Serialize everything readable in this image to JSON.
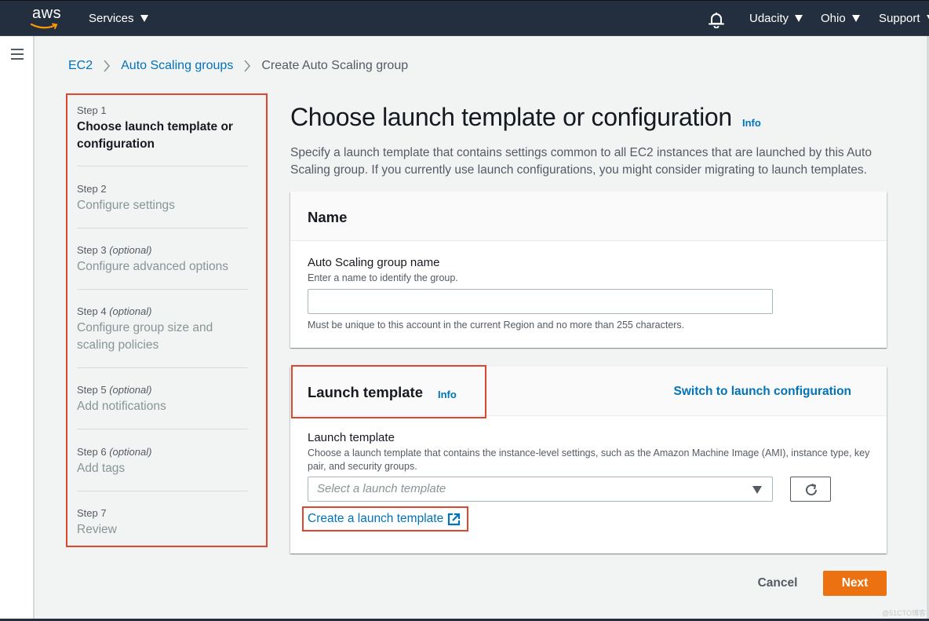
{
  "topnav": {
    "logo": "aws",
    "services_label": "Services",
    "notifications_icon": "bell-icon",
    "account_label": "Udacity",
    "region_label": "Ohio",
    "support_label": "Support"
  },
  "rail": {
    "menu_icon": "hamburger-icon"
  },
  "breadcrumb": [
    {
      "label": "EC2",
      "link": true
    },
    {
      "label": "Auto Scaling groups",
      "link": true
    },
    {
      "label": "Create Auto Scaling group",
      "link": false
    }
  ],
  "steps": [
    {
      "num": "Step 1",
      "optional": "",
      "title": "Choose launch template or configuration",
      "active": true
    },
    {
      "num": "Step 2",
      "optional": "",
      "title": "Configure settings",
      "active": false
    },
    {
      "num": "Step 3",
      "optional": "(optional)",
      "title": "Configure advanced options",
      "active": false
    },
    {
      "num": "Step 4",
      "optional": "(optional)",
      "title": "Configure group size and scaling policies",
      "active": false
    },
    {
      "num": "Step 5",
      "optional": "(optional)",
      "title": "Add notifications",
      "active": false
    },
    {
      "num": "Step 6",
      "optional": "(optional)",
      "title": "Add tags",
      "active": false
    },
    {
      "num": "Step 7",
      "optional": "",
      "title": "Review",
      "active": false
    }
  ],
  "main": {
    "title": "Choose launch template or configuration",
    "info_label": "Info",
    "description": "Specify a launch template that contains settings common to all EC2 instances that are launched by this Auto Scaling group. If you currently use launch configurations, you might consider migrating to launch templates."
  },
  "name_section": {
    "header": "Name",
    "field_label": "Auto Scaling group name",
    "field_description": "Enter a name to identify the group.",
    "input_value": "",
    "input_placeholder": "",
    "constraint": "Must be unique to this account in the current Region and no more than 255 characters."
  },
  "launch_template_section": {
    "header": "Launch template",
    "info_label": "Info",
    "switch_link": "Switch to launch configuration",
    "field_label": "Launch template",
    "field_description": "Choose a launch template that contains the instance-level settings, such as the Amazon Machine Image (AMI), instance type, key pair, and security groups.",
    "select_placeholder": "Select a launch template",
    "refresh_icon": "refresh-icon",
    "create_link": "Create a launch template",
    "external_icon": "external-link-icon"
  },
  "footer": {
    "cancel_label": "Cancel",
    "next_label": "Next"
  },
  "watermark": "@51CTO博客",
  "colors": {
    "nav_bg": "#232f3e",
    "link": "#0073bb",
    "primary_button": "#ec7211",
    "highlight_box": "#e0452f",
    "page_bg": "#f2f3f3"
  }
}
